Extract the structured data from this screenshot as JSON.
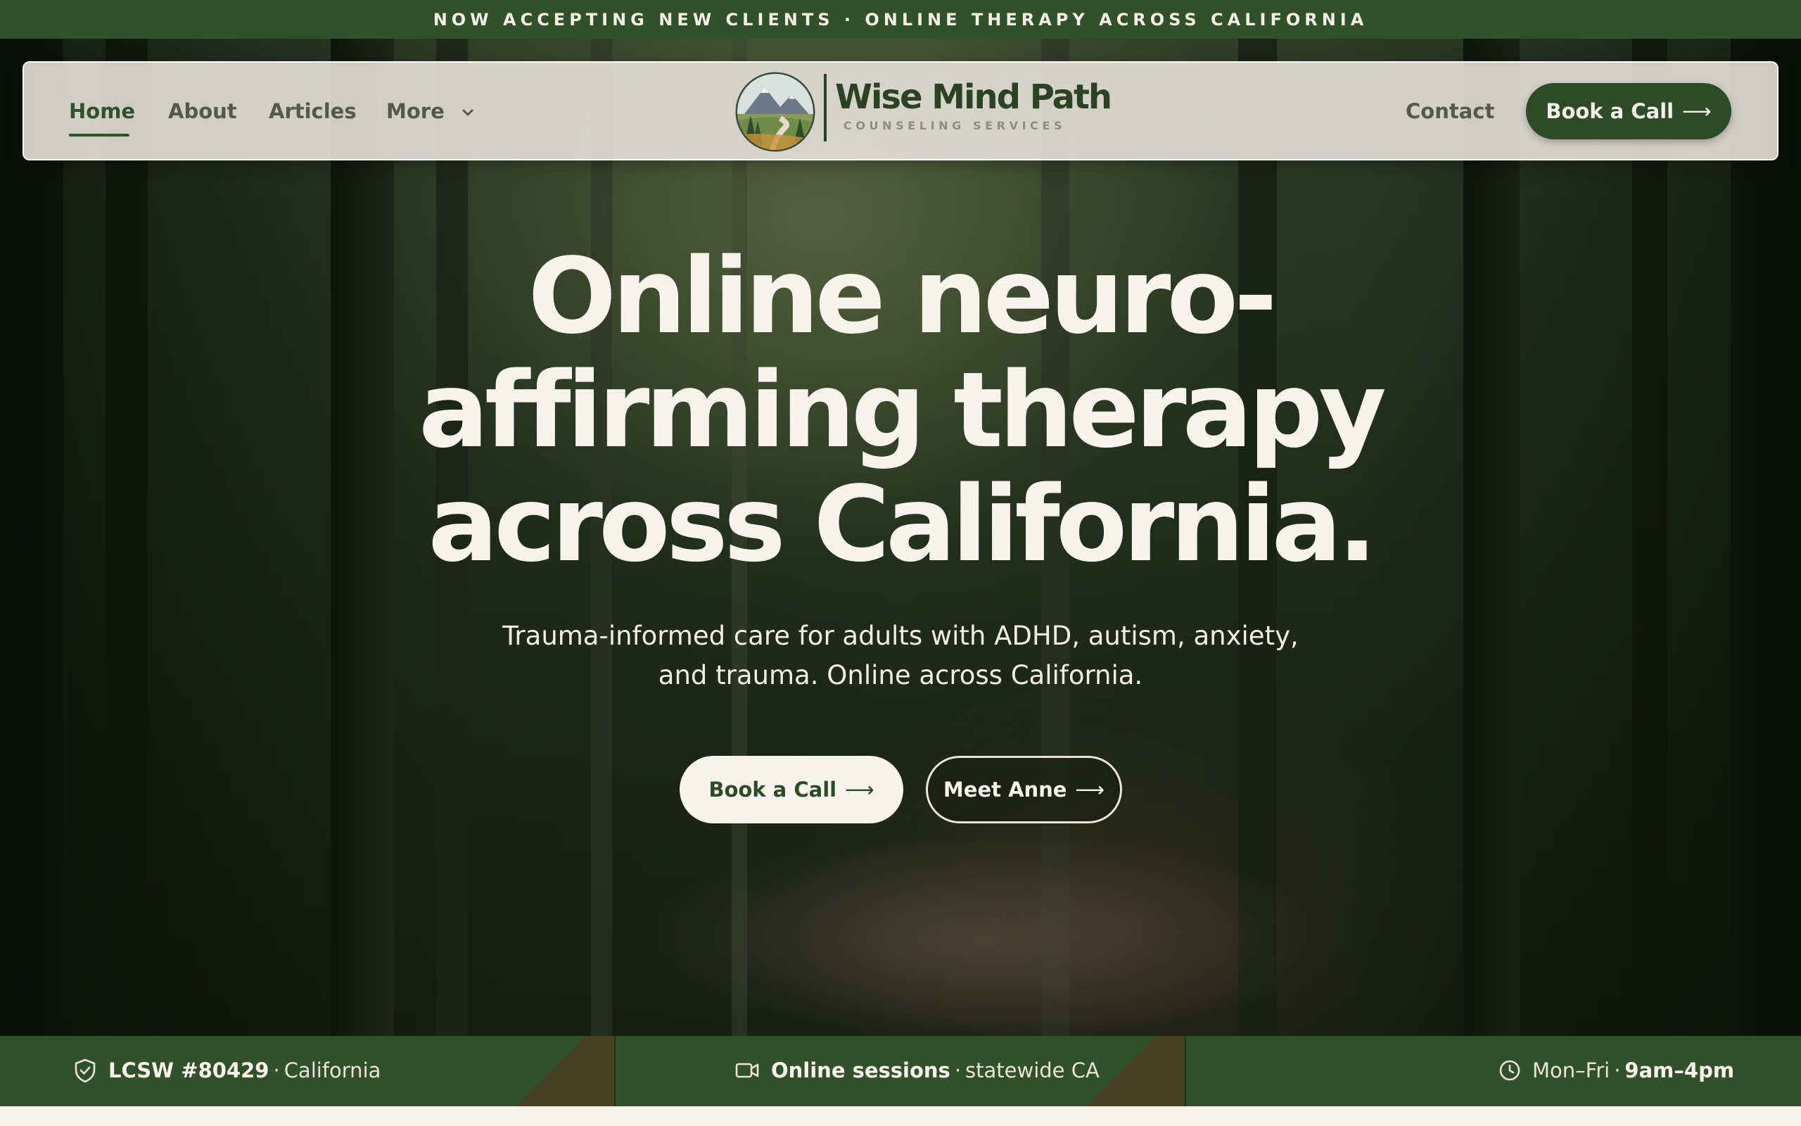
{
  "announcement": {
    "text": "NOW ACCEPTING NEW CLIENTS · ONLINE THERAPY ACROSS CALIFORNIA"
  },
  "nav": {
    "items": [
      {
        "label": "Home",
        "active": true
      },
      {
        "label": "About"
      },
      {
        "label": "Articles"
      },
      {
        "label": "More",
        "has_dropdown": true
      }
    ],
    "contact_label": "Contact",
    "cta_label": "Book a Call",
    "cta_arrow": "⟶"
  },
  "logo": {
    "name": "Wise Mind Path",
    "subtitle": "COUNSELING SERVICES",
    "icon": "mountain-landscape-icon"
  },
  "hero": {
    "headline_lines": [
      "Online neuro-",
      "affirming therapy",
      "across California."
    ],
    "subhead_lines": [
      "Trauma-informed care for adults with ADHD, autism, anxiety,",
      "and trauma. Online across California."
    ],
    "primary_button": "Book a Call",
    "secondary_button": "Meet Anne",
    "arrow": "⟶"
  },
  "info_strip": {
    "license": {
      "icon": "shield-check-icon",
      "bold": "LCSW #80429",
      "rest": "California"
    },
    "sessions": {
      "icon": "video-camera-icon",
      "bold": "Online sessions",
      "rest": "statewide CA"
    },
    "hours": {
      "icon": "clock-icon",
      "prefix": "Mon–Fri",
      "bold": "9am–4pm"
    },
    "separator": "·"
  },
  "colors": {
    "brand_green": "#33502c",
    "cream": "#f6f3ec",
    "dark_green_button": "#2f4a29"
  }
}
